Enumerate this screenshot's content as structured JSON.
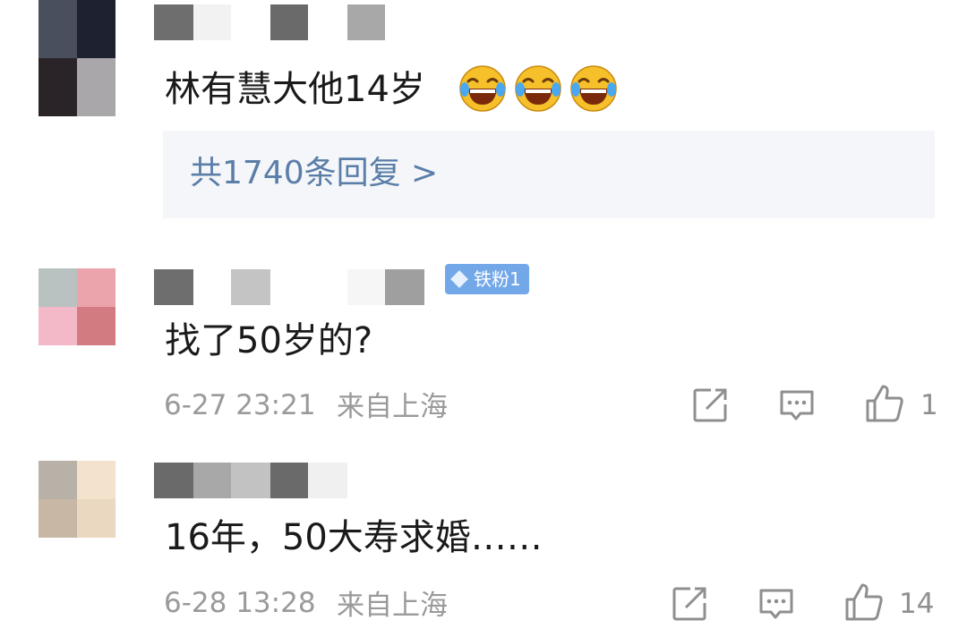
{
  "comments": [
    {
      "text": "林有慧大他14岁",
      "emoji": [
        "laugh-cry-emoji",
        "laugh-cry-emoji",
        "laugh-cry-emoji"
      ],
      "replies_link": "共1740条回复 >"
    },
    {
      "badge": "铁粉1",
      "text": "找了50岁的?",
      "time": "6-27 23:21",
      "location": "来自上海",
      "like_count": "1"
    },
    {
      "text": "16年，50大寿求婚……",
      "time": "6-28 13:28",
      "location": "来自上海",
      "like_count": "14"
    }
  ],
  "icons": [
    "share-icon",
    "comment-icon",
    "like-icon"
  ],
  "colors": {
    "reply_link": "#5a7ea8",
    "badge_bg": "#73a8e8",
    "meta_text": "#9a9a9a",
    "reply_box_bg": "#f4f6f9"
  }
}
